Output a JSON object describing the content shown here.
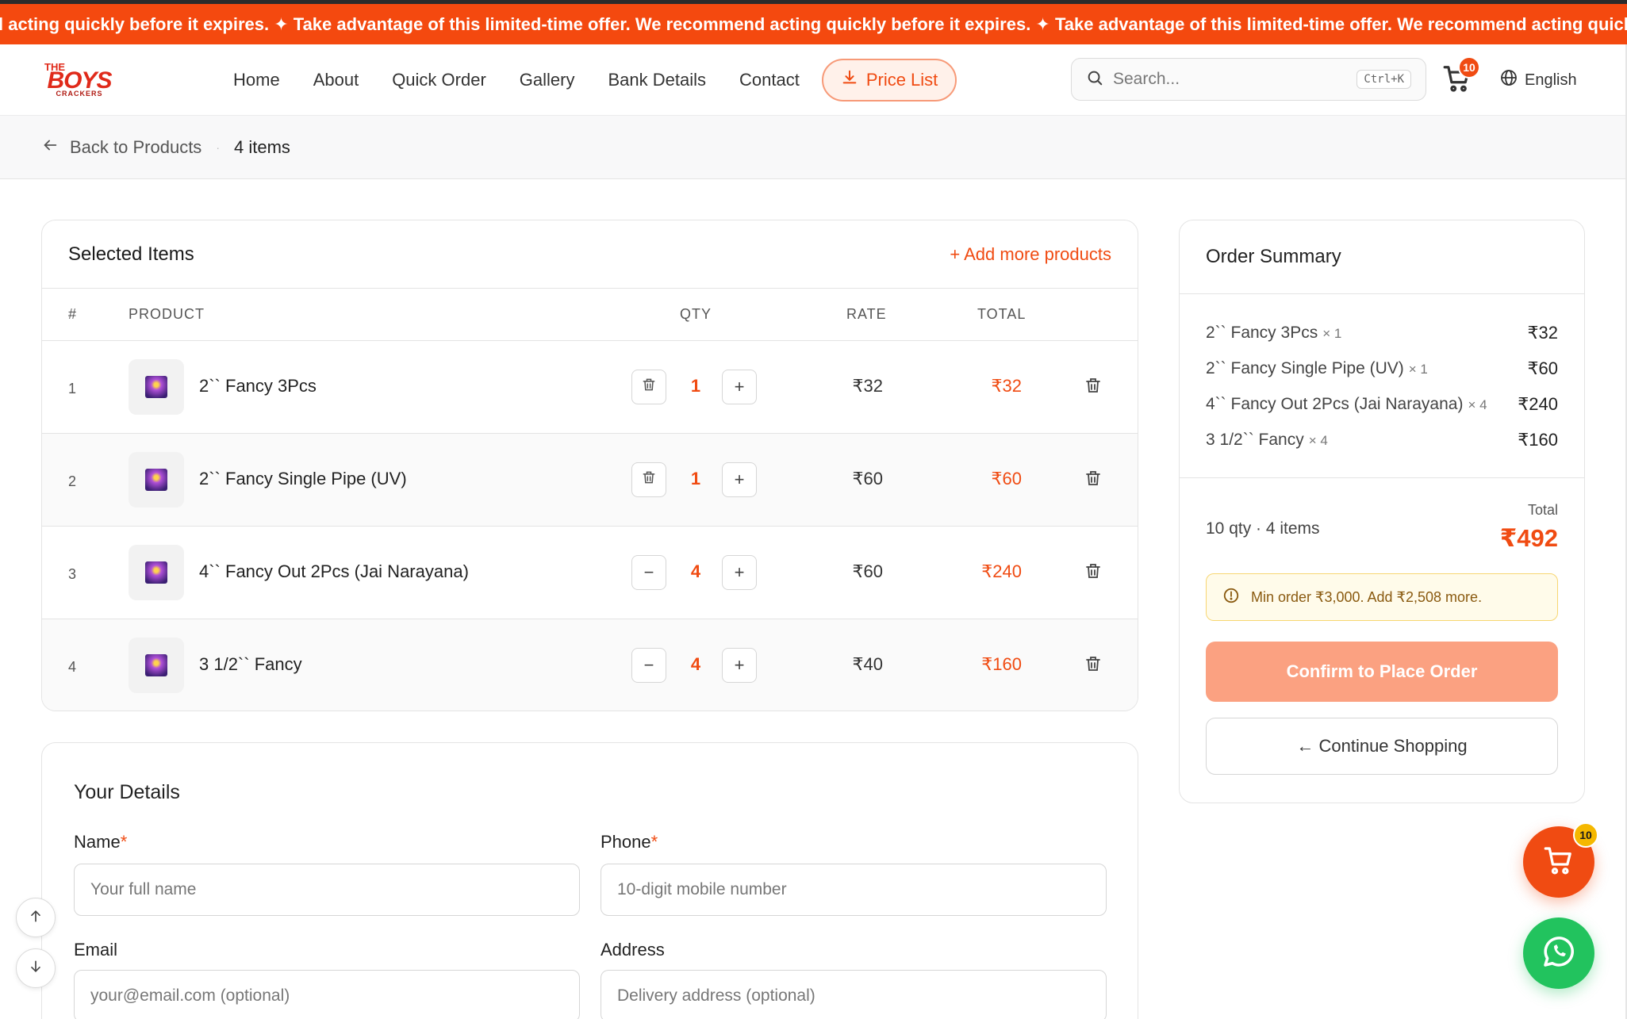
{
  "ticker": {
    "text": "l acting quickly before it expires. ✦ Take advantage of this limited-time offer. We recommend acting quickly before it expires. ✦ Take advantage of this limited-time offer. We recommend acting quickly b"
  },
  "brand": {
    "line1": "THE",
    "line2": "BOYS",
    "line3": "CRACKERS"
  },
  "nav": {
    "items": [
      "Home",
      "About",
      "Quick Order",
      "Gallery",
      "Bank Details",
      "Contact"
    ],
    "price_list": "Price List"
  },
  "search": {
    "placeholder": "Search...",
    "shortcut": "Ctrl+K"
  },
  "cart": {
    "count": "10"
  },
  "language": "English",
  "breadcrumb": {
    "back": "Back to Products",
    "count": "4 items"
  },
  "selected": {
    "title": "Selected Items",
    "add_more": "+ Add more products",
    "headers": {
      "index": "#",
      "product": "PRODUCT",
      "qty": "QTY",
      "rate": "RATE",
      "total": "TOTAL"
    },
    "rows": [
      {
        "index": "1",
        "name": "2`` Fancy 3Pcs",
        "qty": "1",
        "rate": "₹32",
        "total": "₹32",
        "minus": "trash"
      },
      {
        "index": "2",
        "name": "2`` Fancy Single Pipe (UV)",
        "qty": "1",
        "rate": "₹60",
        "total": "₹60",
        "minus": "trash"
      },
      {
        "index": "3",
        "name": "4`` Fancy Out 2Pcs (Jai Narayana)",
        "qty": "4",
        "rate": "₹60",
        "total": "₹240",
        "minus": "minus"
      },
      {
        "index": "4",
        "name": "3 1/2`` Fancy",
        "qty": "4",
        "rate": "₹40",
        "total": "₹160",
        "minus": "minus"
      }
    ]
  },
  "details": {
    "title": "Your Details",
    "name_label": "Name",
    "name_placeholder": "Your full name",
    "phone_label": "Phone",
    "phone_placeholder": "10-digit mobile number",
    "email_label": "Email",
    "email_placeholder": "your@email.com (optional)",
    "address_label": "Address",
    "address_placeholder": "Delivery address (optional)",
    "required_mark": "*"
  },
  "summary": {
    "title": "Order Summary",
    "items": [
      {
        "name": "2`` Fancy 3Pcs",
        "qty": "× 1",
        "amount": "₹32"
      },
      {
        "name": "2`` Fancy Single Pipe (UV)",
        "qty": "× 1",
        "amount": "₹60"
      },
      {
        "name": "4`` Fancy Out 2Pcs (Jai Narayana)",
        "qty": "× 4",
        "amount": "₹240"
      },
      {
        "name": "3 1/2`` Fancy",
        "qty": "× 4",
        "amount": "₹160"
      }
    ],
    "qty_text": "10 qty · 4 items",
    "total_label": "Total",
    "total_value": "₹492",
    "alert": "Min order ₹3,000. Add ₹2,508 more.",
    "confirm": "Confirm to Place Order",
    "continue": "← Continue Shopping"
  },
  "fab": {
    "cart_count": "10"
  },
  "colors": {
    "accent": "#f04b12",
    "confirm": "#fba181",
    "whatsapp": "#22c35e",
    "badge": "#f5b800"
  }
}
